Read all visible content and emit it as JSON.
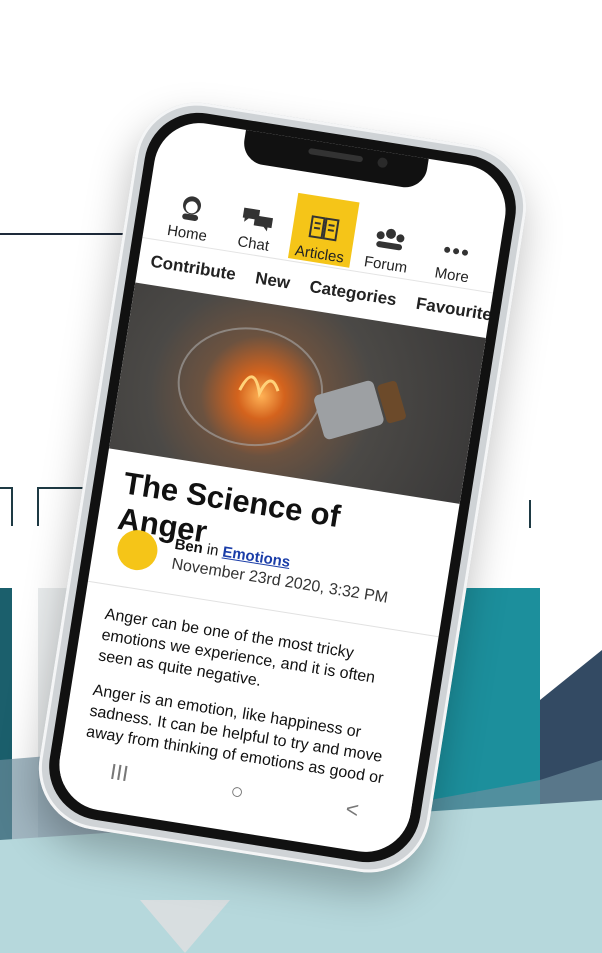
{
  "nav": {
    "items": [
      {
        "label": "Home",
        "icon": "home-avatar-icon"
      },
      {
        "label": "Chat",
        "icon": "chat-icon"
      },
      {
        "label": "Articles",
        "icon": "articles-icon",
        "active": true
      },
      {
        "label": "Forum",
        "icon": "forum-icon"
      },
      {
        "label": "More",
        "icon": "more-icon"
      }
    ],
    "active_color": "#f5c518"
  },
  "subnav": {
    "items": [
      "Contribute",
      "New",
      "Categories",
      "Favourites"
    ]
  },
  "article": {
    "title": "The Science of Anger",
    "author": "Ben",
    "in_text": "in",
    "category": "Emotions",
    "date": "November 23rd 2020, 3:32 PM",
    "paragraphs": [
      "Anger can be one of the most tricky emotions we experience, and it is often seen as quite negative.",
      "Anger is an emotion, like happiness or sadness. It can be helpful to try and move away from thinking of emotions as good or"
    ]
  },
  "system_nav": {
    "recent": "III",
    "home": "○",
    "back": "<"
  }
}
